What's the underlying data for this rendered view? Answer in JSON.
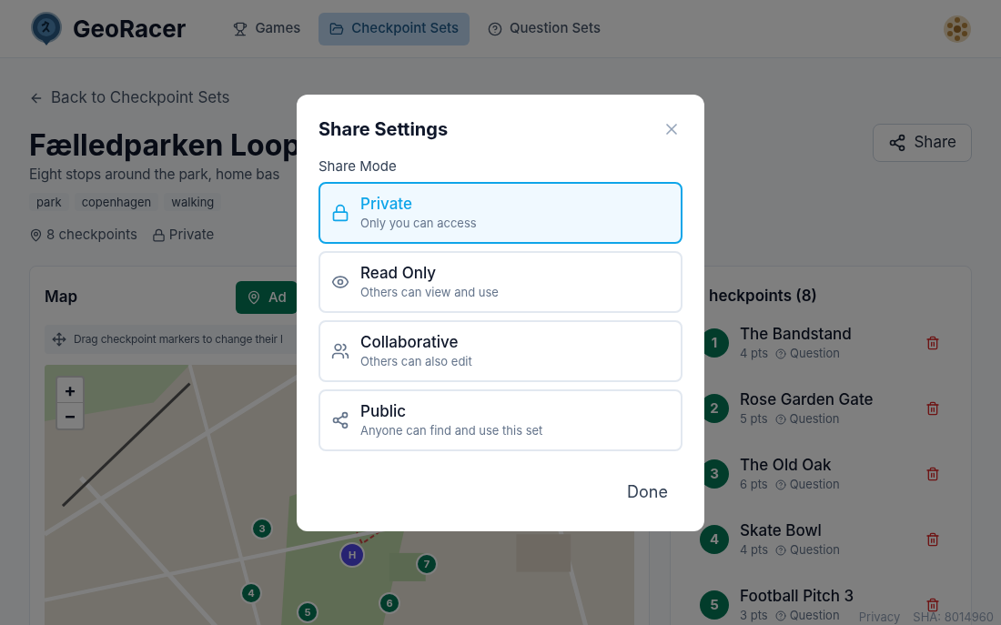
{
  "header": {
    "brand": "GeoRacer",
    "nav": [
      {
        "label": "Games",
        "selected": false
      },
      {
        "label": "Checkpoint Sets",
        "selected": true
      },
      {
        "label": "Question Sets",
        "selected": false
      }
    ]
  },
  "page": {
    "back_link": "Back to Checkpoint Sets",
    "title": "Fælledparken Loop",
    "description": "Eight stops around the park, home bas",
    "tags": [
      "park",
      "copenhagen",
      "walking"
    ],
    "meta": {
      "checkpoints": "8 checkpoints",
      "visibility": "Private"
    },
    "share_button": "Share"
  },
  "map_panel": {
    "title": "Map",
    "add_button": "Ad",
    "hint": "Drag checkpoint markers to change their l",
    "zoom_in": "+",
    "zoom_out": "−",
    "markers": [
      {
        "kind": "checkpoint",
        "label": "3"
      },
      {
        "kind": "checkpoint",
        "label": "4"
      },
      {
        "kind": "checkpoint",
        "label": "5"
      },
      {
        "kind": "checkpoint",
        "label": "6"
      },
      {
        "kind": "checkpoint",
        "label": "7"
      },
      {
        "kind": "home",
        "label": "H"
      }
    ]
  },
  "checkpoints_panel": {
    "title": "heckpoints (8)",
    "items": [
      {
        "number": "1",
        "name": "The Bandstand",
        "points": "4 pts",
        "type": "Question"
      },
      {
        "number": "2",
        "name": "Rose Garden Gate",
        "points": "5 pts",
        "type": "Question"
      },
      {
        "number": "3",
        "name": "The Old Oak",
        "points": "6 pts",
        "type": "Question"
      },
      {
        "number": "4",
        "name": "Skate Bowl",
        "points": "4 pts",
        "type": "Question"
      },
      {
        "number": "5",
        "name": "Football Pitch 3",
        "points": "3 pts",
        "type": "Question"
      }
    ]
  },
  "footer": {
    "links": [
      "Privacy",
      "SHA: 8014960"
    ]
  },
  "dialog": {
    "title": "Share Settings",
    "section_label": "Share Mode",
    "options": [
      {
        "kind": "private",
        "title": "Private",
        "description": "Only you can access",
        "selected": true
      },
      {
        "kind": "read_only",
        "title": "Read Only",
        "description": "Others can view and use",
        "selected": false
      },
      {
        "kind": "collaborative",
        "title": "Collaborative",
        "description": "Others can also edit",
        "selected": false
      },
      {
        "kind": "public",
        "title": "Public",
        "description": "Anyone can find and use this set",
        "selected": false
      }
    ],
    "done_button": "Done"
  }
}
